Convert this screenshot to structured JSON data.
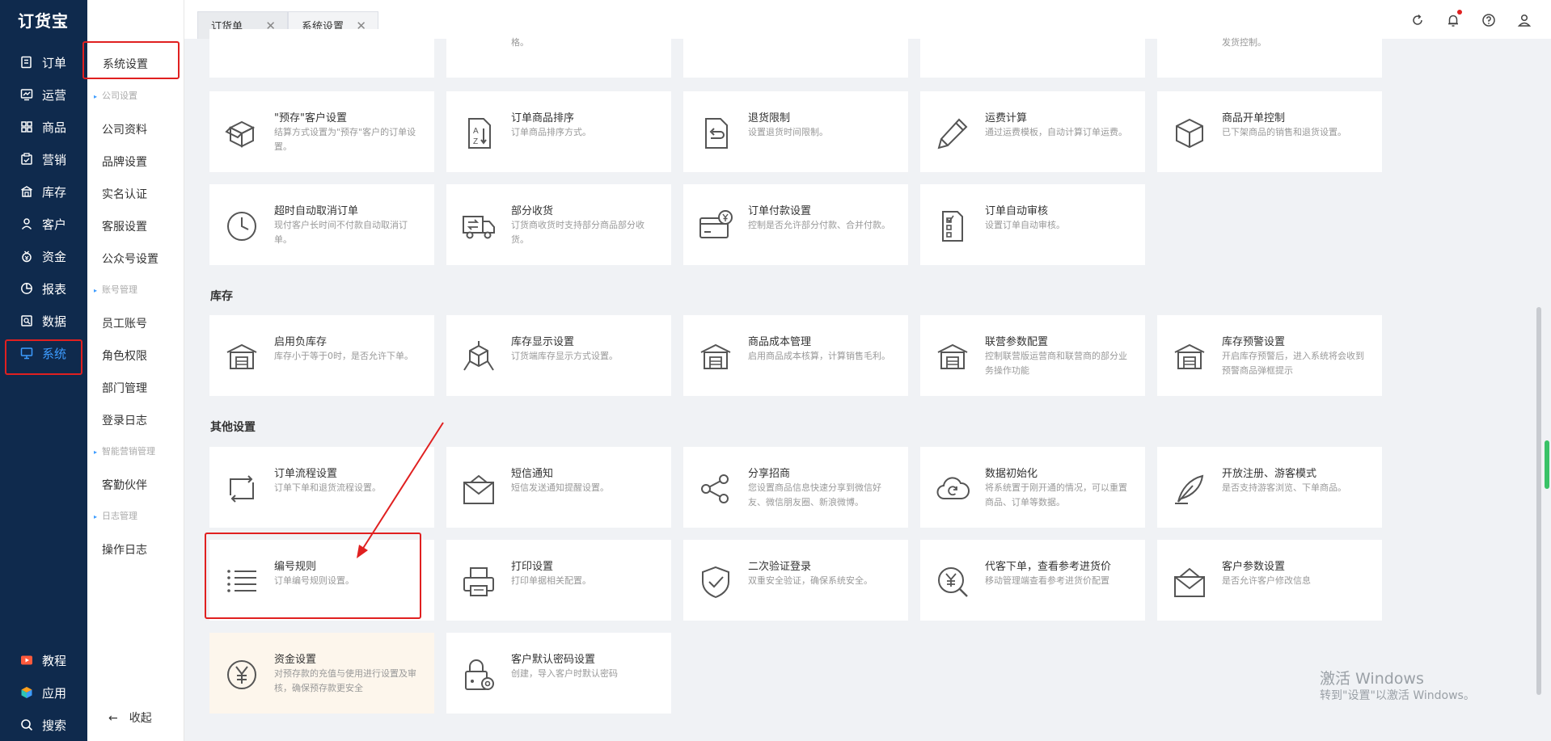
{
  "app": {
    "logo": "订货宝"
  },
  "nav": {
    "items": [
      {
        "label": "订单",
        "icon": "order-icon"
      },
      {
        "label": "运营",
        "icon": "operation-icon"
      },
      {
        "label": "商品",
        "icon": "product-icon"
      },
      {
        "label": "营销",
        "icon": "marketing-icon"
      },
      {
        "label": "库存",
        "icon": "warehouse-icon"
      },
      {
        "label": "客户",
        "icon": "customer-icon"
      },
      {
        "label": "资金",
        "icon": "funds-icon"
      },
      {
        "label": "报表",
        "icon": "report-icon"
      },
      {
        "label": "数据",
        "icon": "data-icon"
      },
      {
        "label": "系统",
        "icon": "system-icon"
      }
    ],
    "bottom": [
      {
        "label": "教程",
        "icon": "tutorial-icon"
      },
      {
        "label": "应用",
        "icon": "apps-icon"
      },
      {
        "label": "搜索",
        "icon": "search-icon"
      }
    ]
  },
  "sub": {
    "top": "系统设置",
    "groups": [
      "公司设置",
      "账号管理",
      "智能营销管理",
      "日志管理"
    ],
    "items": [
      "公司资料",
      "品牌设置",
      "实名认证",
      "客服设置",
      "公众号设置",
      "员工账号",
      "角色权限",
      "部门管理",
      "登录日志",
      "客勤伙伴",
      "操作日志"
    ],
    "collapse": "收起"
  },
  "tabs": [
    {
      "label": "订货单",
      "close": "✕"
    },
    {
      "label": "系统设置",
      "close": "✕"
    }
  ],
  "top_partial": {
    "descs": [
      "格。",
      "发货控制。"
    ]
  },
  "sections": {
    "stock": "库存",
    "other": "其他设置"
  },
  "cards": {
    "order": [
      {
        "title": "\"预存\"客户设置",
        "desc": "结算方式设置为\"预存\"客户的订单设置。",
        "icon": "box-open-icon"
      },
      {
        "title": "订单商品排序",
        "desc": "订单商品排序方式。",
        "icon": "sort-az-icon"
      },
      {
        "title": "退货限制",
        "desc": "设置退货时间限制。",
        "icon": "return-doc-icon"
      },
      {
        "title": "运费计算",
        "desc": "通过运费模板，自动计算订单运费。",
        "icon": "pencil-icon"
      },
      {
        "title": "商品开单控制",
        "desc": "已下架商品的销售和退货设置。",
        "icon": "cube-icon"
      },
      {
        "title": "超时自动取消订单",
        "desc": "现付客户长时间不付款自动取消订单。",
        "icon": "clock-icon"
      },
      {
        "title": "部分收货",
        "desc": "订货商收货时支持部分商品部分收货。",
        "icon": "truck-icon"
      },
      {
        "title": "订单付款设置",
        "desc": "控制是否允许部分付款、合并付款。",
        "icon": "payment-card-icon"
      },
      {
        "title": "订单自动审核",
        "desc": "设置订单自动审核。",
        "icon": "checklist-icon"
      }
    ],
    "stock": [
      {
        "title": "启用负库存",
        "desc": "库存小于等于0时，是否允许下单。",
        "icon": "warehouse-icon"
      },
      {
        "title": "库存显示设置",
        "desc": "订货端库存显示方式设置。",
        "icon": "cube-network-icon"
      },
      {
        "title": "商品成本管理",
        "desc": "启用商品成本核算，计算销售毛利。",
        "icon": "warehouse-icon"
      },
      {
        "title": "联营参数配置",
        "desc": "控制联营版运营商和联营商的部分业务操作功能",
        "icon": "warehouse-icon"
      },
      {
        "title": "库存预警设置",
        "desc": "开启库存预警后，进入系统将会收到预警商品弹框提示",
        "icon": "warehouse-icon"
      }
    ],
    "other": [
      {
        "title": "订单流程设置",
        "desc": "订单下单和退货流程设置。",
        "icon": "flow-arrows-icon"
      },
      {
        "title": "短信通知",
        "desc": "短信发送通知提醒设置。",
        "icon": "envelope-icon"
      },
      {
        "title": "分享招商",
        "desc": "您设置商品信息快速分享到微信好友、微信朋友圈、新浪微博。",
        "icon": "share-icon"
      },
      {
        "title": "数据初始化",
        "desc": "将系统置于刚开通的情况，可以重置商品、订单等数据。",
        "icon": "cloud-refresh-icon"
      },
      {
        "title": "开放注册、游客模式",
        "desc": "是否支持游客浏览、下单商品。",
        "icon": "feather-icon"
      },
      {
        "title": "编号规则",
        "desc": "订单编号规则设置。",
        "icon": "list-icon"
      },
      {
        "title": "打印设置",
        "desc": "打印单据相关配置。",
        "icon": "printer-icon"
      },
      {
        "title": "二次验证登录",
        "desc": "双重安全验证，确保系统安全。",
        "icon": "shield-check-icon"
      },
      {
        "title": "代客下单，查看参考进货价",
        "desc": "移动管理端查看参考进货价配置",
        "icon": "yuan-search-icon"
      },
      {
        "title": "客户参数设置",
        "desc": "是否允许客户修改信息",
        "icon": "envelope-open-icon"
      },
      {
        "title": "资金设置",
        "desc": "对预存款的充值与使用进行设置及审核，确保预存款更安全",
        "icon": "yuan-circle-icon"
      },
      {
        "title": "客户默认密码设置",
        "desc": "创建，导入客户时默认密码",
        "icon": "lock-gear-icon"
      }
    ]
  },
  "watermark": {
    "line1": "激活 Windows",
    "line2": "转到\"设置\"以激活 Windows。"
  },
  "colors": {
    "nav_bg": "#0f2a4d",
    "active": "#3d9cff",
    "highlight": "#e02020"
  }
}
